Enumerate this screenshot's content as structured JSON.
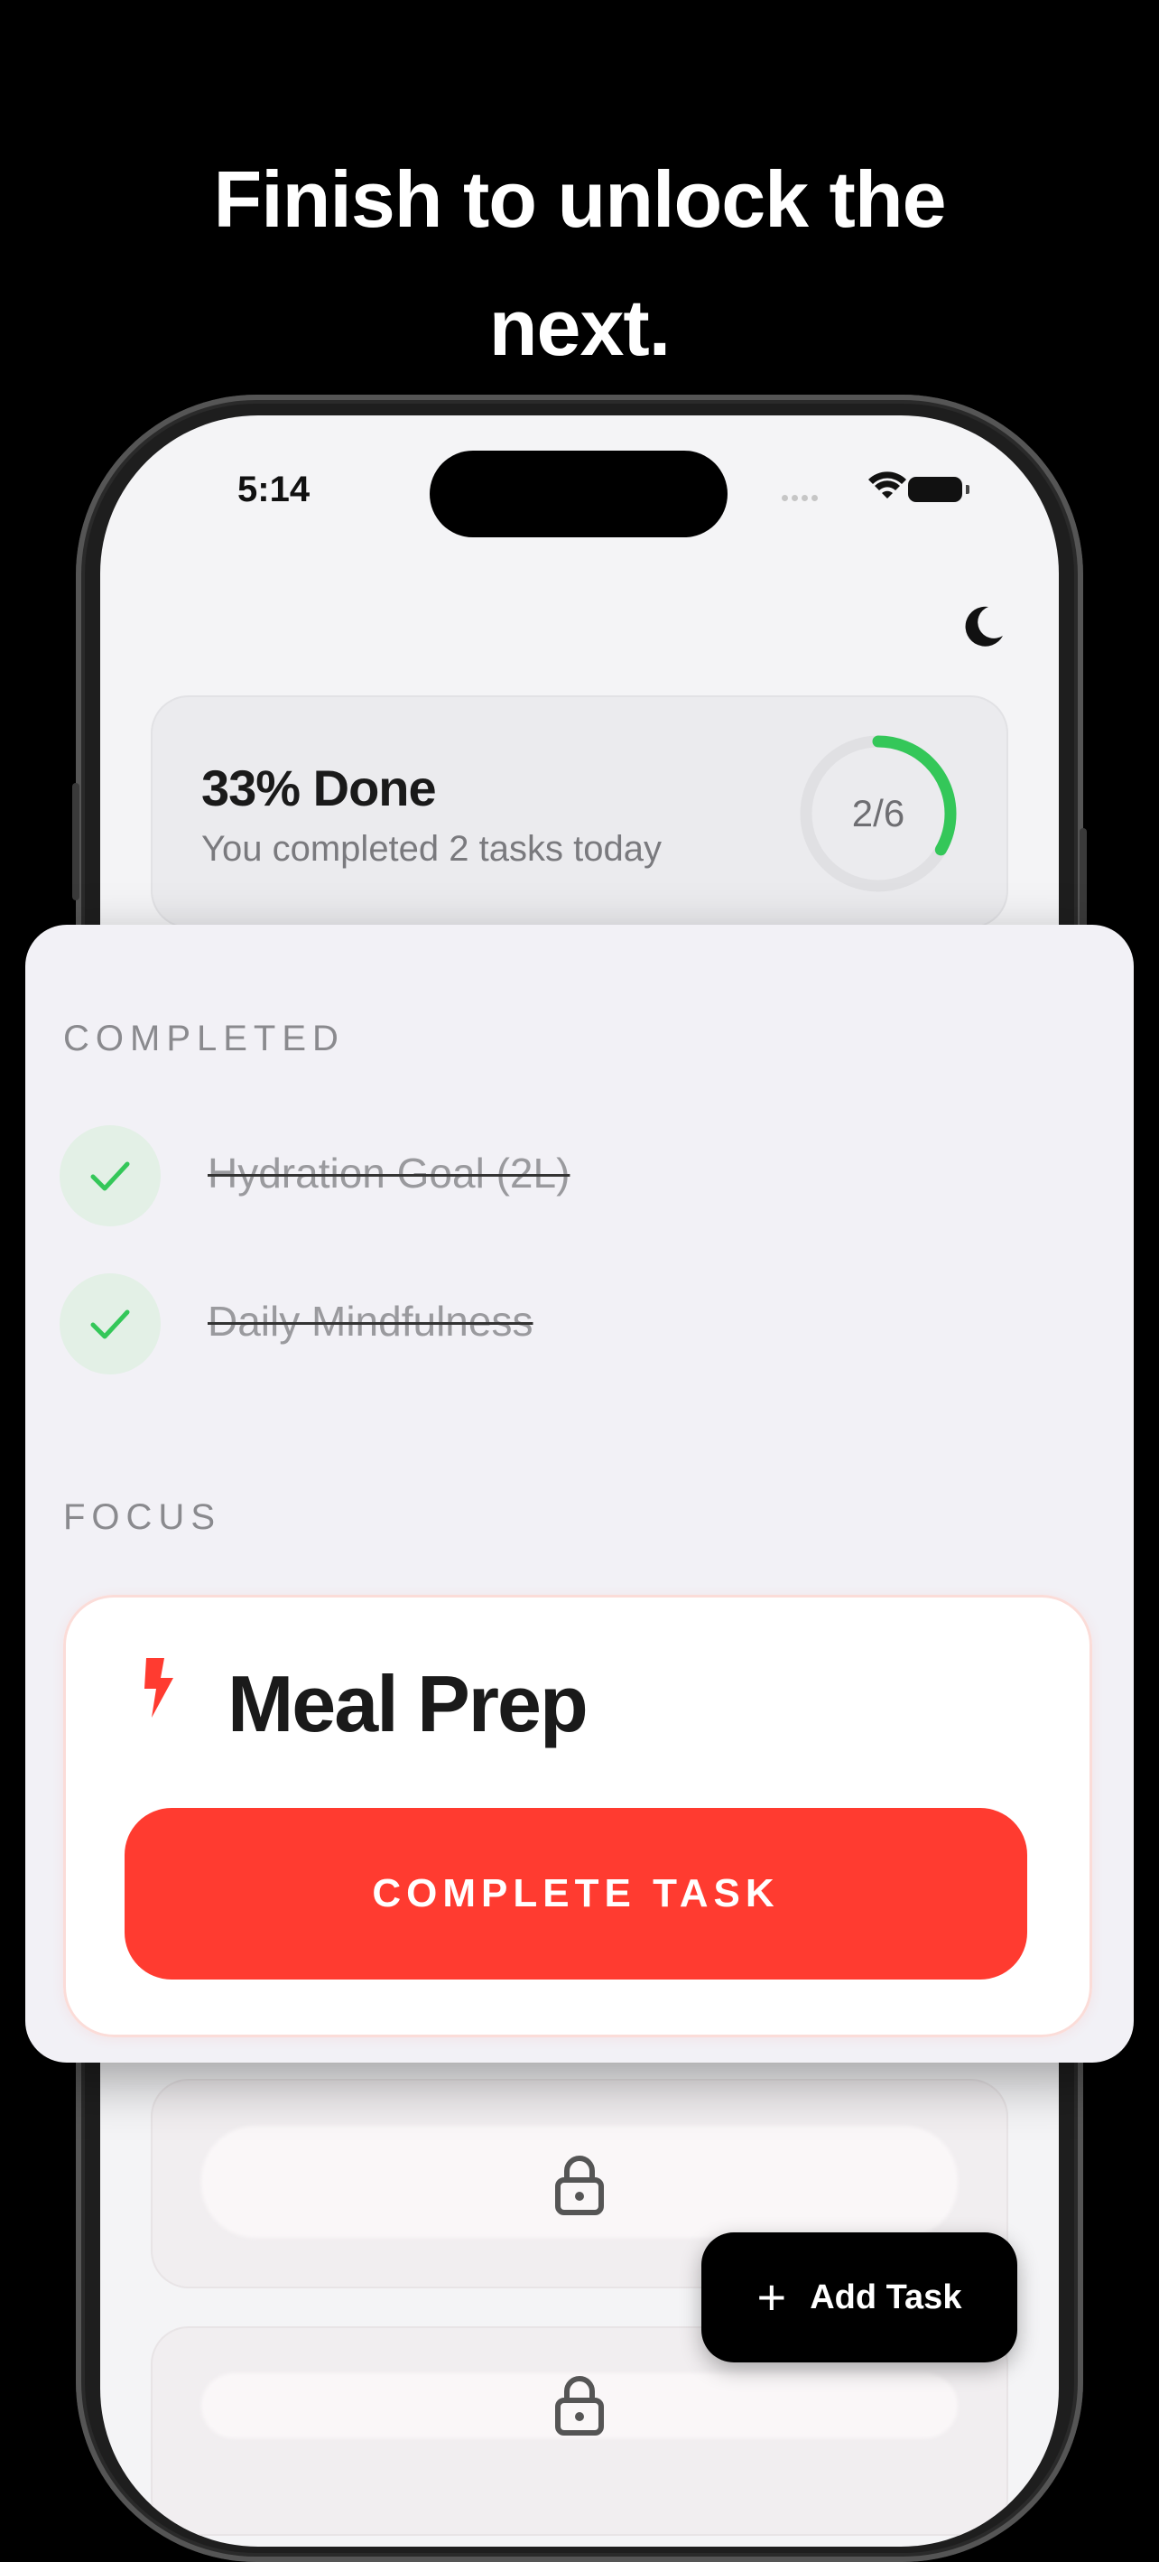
{
  "headline": {
    "line1": "Finish to unlock the",
    "line2": "next."
  },
  "status_bar": {
    "time": "5:14"
  },
  "summary": {
    "title": "33% Done",
    "subtitle": "You completed 2 tasks today",
    "progress_label": "2/6",
    "progress_fraction": 0.333,
    "progress_color": "#34c759"
  },
  "completed_section": {
    "label": "COMPLETED",
    "items": [
      {
        "title": "Hydration Goal (2L)"
      },
      {
        "title": "Daily Mindfulness"
      }
    ]
  },
  "focus_section": {
    "label": "FOCUS",
    "task_title": "Meal Prep",
    "button_label": "COMPLETE TASK",
    "accent_color": "#ff3b30"
  },
  "fab": {
    "label": "Add Task",
    "icon": "plus-icon"
  }
}
